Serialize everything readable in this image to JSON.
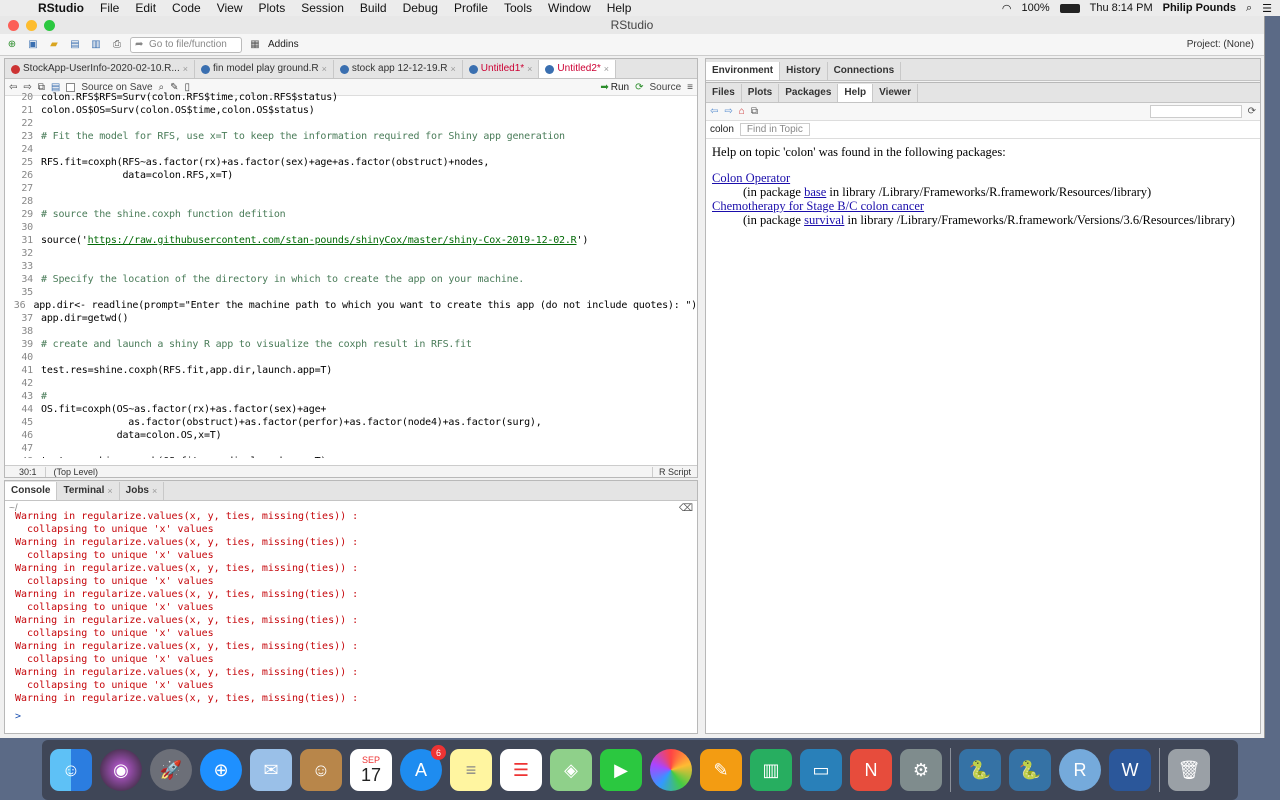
{
  "menubar": {
    "app": "RStudio",
    "items": [
      "File",
      "Edit",
      "Code",
      "View",
      "Plots",
      "Session",
      "Build",
      "Debug",
      "Profile",
      "Tools",
      "Window",
      "Help"
    ],
    "battery": "100%",
    "clock": "Thu 8:14 PM",
    "user": "Philip Pounds"
  },
  "window": {
    "title": "RStudio"
  },
  "toolbar": {
    "goto_placeholder": "Go to file/function",
    "addins": "Addins",
    "project": "Project: (None)"
  },
  "editor": {
    "tabs": [
      {
        "label": "StockApp-UserInfo-2020-02-10.R...",
        "unsaved": false
      },
      {
        "label": "fin model play ground.R",
        "unsaved": false
      },
      {
        "label": "stock app 12-12-19.R",
        "unsaved": false
      },
      {
        "label": "Untitled1*",
        "unsaved": true
      },
      {
        "label": "Untitled2*",
        "unsaved": true
      }
    ],
    "source_on_save": "Source on Save",
    "run": "Run",
    "source": "Source",
    "lines": [
      {
        "n": "20",
        "t": "colon.RFS$RFS=Surv(colon.RFS$time,colon.RFS$status)",
        "k": "code"
      },
      {
        "n": "21",
        "t": "colon.OS$OS=Surv(colon.OS$time,colon.OS$status)",
        "k": "code"
      },
      {
        "n": "22",
        "t": "",
        "k": "code"
      },
      {
        "n": "23",
        "t": "# Fit the model for RFS, use x=T to keep the information required for Shiny app generation",
        "k": "cm"
      },
      {
        "n": "24",
        "t": "",
        "k": "code"
      },
      {
        "n": "25",
        "t": "RFS.fit=coxph(RFS~as.factor(rx)+as.factor(sex)+age+as.factor(obstruct)+nodes,",
        "k": "code"
      },
      {
        "n": "26",
        "t": "              data=colon.RFS,x=T)",
        "k": "code"
      },
      {
        "n": "27",
        "t": "",
        "k": "code"
      },
      {
        "n": "28",
        "t": "",
        "k": "code"
      },
      {
        "n": "29",
        "t": "# source the shine.coxph function defition",
        "k": "cm"
      },
      {
        "n": "30",
        "t": "",
        "k": "code"
      },
      {
        "n": "31",
        "t": "source('https://raw.githubusercontent.com/stan-pounds/shinyCox/master/shiny-Cox-2019-12-02.R')",
        "k": "src"
      },
      {
        "n": "32",
        "t": "",
        "k": "code"
      },
      {
        "n": "33",
        "t": "",
        "k": "code"
      },
      {
        "n": "34",
        "t": "# Specify the location of the directory in which to create the app on your machine.",
        "k": "cm"
      },
      {
        "n": "35",
        "t": "",
        "k": "code"
      },
      {
        "n": "36",
        "t": "app.dir<- readline(prompt=\"Enter the machine path to which you want to create this app (do not include quotes): \")",
        "k": "code"
      },
      {
        "n": "37",
        "t": "app.dir=getwd()",
        "k": "code"
      },
      {
        "n": "38",
        "t": "",
        "k": "code"
      },
      {
        "n": "39",
        "t": "# create and launch a shiny R app to visualize the coxph result in RFS.fit",
        "k": "cm"
      },
      {
        "n": "40",
        "t": "",
        "k": "code"
      },
      {
        "n": "41",
        "t": "test.res=shine.coxph(RFS.fit,app.dir,launch.app=T)",
        "k": "code"
      },
      {
        "n": "42",
        "t": "",
        "k": "code"
      },
      {
        "n": "43",
        "t": "#",
        "k": "cm"
      },
      {
        "n": "44",
        "t": "OS.fit=coxph(OS~as.factor(rx)+as.factor(sex)+age+",
        "k": "code"
      },
      {
        "n": "45",
        "t": "               as.factor(obstruct)+as.factor(perfor)+as.factor(node4)+as.factor(surg),",
        "k": "code"
      },
      {
        "n": "46",
        "t": "             data=colon.OS,x=T)",
        "k": "code"
      },
      {
        "n": "47",
        "t": "",
        "k": "code"
      },
      {
        "n": "48",
        "t": "test.res=shine.coxph(OS.fit,app.dir,launch.app=T)",
        "k": "code"
      }
    ],
    "status_pos": "30:1",
    "status_scope": "(Top Level)",
    "status_type": "R Script"
  },
  "console": {
    "tabs": [
      "Console",
      "Terminal",
      "Jobs"
    ],
    "path": "~/",
    "lines": [
      "Warning in regularize.values(x, y, ties, missing(ties)) :",
      "  collapsing to unique 'x' values",
      "Warning in regularize.values(x, y, ties, missing(ties)) :",
      "  collapsing to unique 'x' values",
      "Warning in regularize.values(x, y, ties, missing(ties)) :",
      "  collapsing to unique 'x' values",
      "Warning in regularize.values(x, y, ties, missing(ties)) :",
      "  collapsing to unique 'x' values",
      "Warning in regularize.values(x, y, ties, missing(ties)) :",
      "  collapsing to unique 'x' values",
      "Warning in regularize.values(x, y, ties, missing(ties)) :",
      "  collapsing to unique 'x' values",
      "Warning in regularize.values(x, y, ties, missing(ties)) :",
      "  collapsing to unique 'x' values",
      "Warning in regularize.values(x, y, ties, missing(ties)) :",
      "  collapsing to unique 'x' values"
    ],
    "prompt": ">"
  },
  "env": {
    "tabs": [
      "Environment",
      "History",
      "Connections"
    ]
  },
  "files": {
    "tabs": [
      "Files",
      "Plots",
      "Packages",
      "Help",
      "Viewer"
    ],
    "topic": "colon",
    "find_placeholder": "Find in Topic",
    "help_heading": "Help on topic 'colon' was found in the following packages:",
    "results": [
      {
        "link": "Colon Operator",
        "pre": "(in package ",
        "pkg": "base",
        "post": " in library /Library/Frameworks/R.framework/Resources/library)"
      },
      {
        "link": "Chemotherapy for Stage B/C colon cancer",
        "pre": "(in package ",
        "pkg": "survival",
        "post": " in library /Library/Frameworks/R.framework/Versions/3.6/Resources/library)"
      }
    ]
  },
  "dock": {
    "calendar_month": "SEP",
    "calendar_day": "17",
    "appstore_badge": "6"
  }
}
